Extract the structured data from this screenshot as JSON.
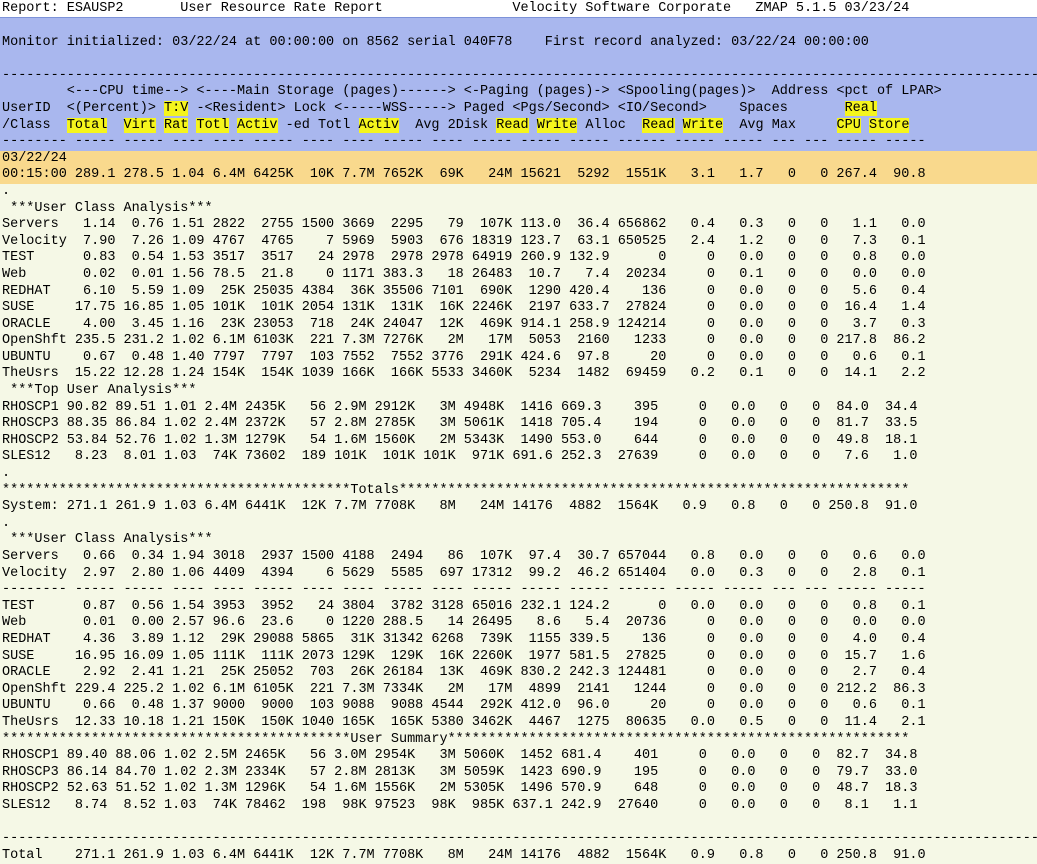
{
  "title_bar": "Report: ESAUSP2       User Resource Rate Report                Velocity Software Corporate   ZMAP 5.1.5 03/23/24",
  "monitor_line": "Monitor initialized: 03/22/24 at 00:00:00 on 8562 serial 040F78    First record analyzed: 03/22/24 00:00:00",
  "header": {
    "sep": "------------------------------------------------------------------------------------------------------------------------------------",
    "h1": "        <---CPU time--> <----Main Storage (pages)------> <-Paging (pages)-> <Spooling(pages)>  Address <pct of LPAR>",
    "h2_a": "UserID  <(Percent)> ",
    "h2_tv": "T:V",
    "h2_b": " -<Resident> Lock <-----WSS-----> Paged <Pgs/Second> <IO/Second>    Spaces       ",
    "h2_real": "Real",
    "h3_a": "/Class  ",
    "h3_total": "Total",
    "h3_s1": "  ",
    "h3_virt": "Virt",
    "h3_s2": " ",
    "h3_rat": "Rat",
    "h3_s3": " ",
    "h3_totl": "Totl",
    "h3_s4": " ",
    "h3_activ": "Activ",
    "h3_s5": " -ed Totl ",
    "h3_activ2": "Activ",
    "h3_s6": "  Avg 2Disk ",
    "h3_read": "Read",
    "h3_s7": " ",
    "h3_write": "Write",
    "h3_s8": " Alloc  ",
    "h3_read2": "Read",
    "h3_s9": " ",
    "h3_write2": "Write",
    "h3_s10": "  Avg Max     ",
    "h3_cpu": "CPU",
    "h3_s11": " ",
    "h3_store": "Store",
    "h4": "-------- ----- ----- ---- ---- ----- ---- ---- ----- ---- ----- ----- ----- ------ ----- ----- --- --- ----- -----"
  },
  "first_block": {
    "date": "03/22/24",
    "row": "00:15:00 289.1 278.5 1.04 6.4M 6425K  10K 7.7M 7652K  69K   24M 15621  5292  1551K   3.1   1.7   0   0 267.4  90.8"
  },
  "lines": [
    ".",
    " ***User Class Analysis***",
    "Servers   1.14  0.76 1.51 2822  2755 1500 3669  2295   79  107K 113.0  36.4 656862   0.4   0.3   0   0   1.1   0.0",
    "Velocity  7.90  7.26 1.09 4767  4765    7 5969  5903  676 18319 123.7  63.1 650525   2.4   1.2   0   0   7.3   0.1",
    "TEST      0.83  0.54 1.53 3517  3517   24 2978  2978 2978 64919 260.9 132.9      0     0   0.0   0   0   0.8   0.0",
    "Web       0.02  0.01 1.56 78.5  21.8    0 1171 383.3   18 26483  10.7   7.4  20234     0   0.1   0   0   0.0   0.0",
    "REDHAT    6.10  5.59 1.09  25K 25035 4384  36K 35506 7101  690K  1290 420.4    136     0   0.0   0   0   5.6   0.4",
    "SUSE     17.75 16.85 1.05 101K  101K 2054 131K  131K  16K 2246K  2197 633.7  27824     0   0.0   0   0  16.4   1.4",
    "ORACLE    4.00  3.45 1.16  23K 23053  718  24K 24047  12K  469K 914.1 258.9 124214     0   0.0   0   0   3.7   0.3",
    "OpenShft 235.5 231.2 1.02 6.1M 6103K  221 7.3M 7276K   2M   17M  5053  2160   1233     0   0.0   0   0 217.8  86.2",
    "UBUNTU    0.67  0.48 1.40 7797  7797  103 7552  7552 3776  291K 424.6  97.8     20     0   0.0   0   0   0.6   0.1",
    "TheUsrs  15.22 12.28 1.24 154K  154K 1039 166K  166K 5533 3460K  5234  1482  69459   0.2   0.1   0   0  14.1   2.2",
    " ***Top User Analysis***",
    "RHOSCP1 90.82 89.51 1.01 2.4M 2435K   56 2.9M 2912K   3M 4948K  1416 669.3    395     0   0.0   0   0  84.0  34.4",
    "RHOSCP3 88.35 86.84 1.02 2.4M 2372K   57 2.8M 2785K   3M 5061K  1418 705.4    194     0   0.0   0   0  81.7  33.5",
    "RHOSCP2 53.84 52.76 1.02 1.3M 1279K   54 1.6M 1560K   2M 5343K  1490 553.0    644     0   0.0   0   0  49.8  18.1",
    "SLES12   8.23  8.01 1.03  74K 73602  189 101K  101K 101K  971K 691.6 252.3  27639     0   0.0   0   0   7.6   1.0",
    ".",
    "*******************************************Totals***************************************************************",
    "System: 271.1 261.9 1.03 6.4M 6441K  12K 7.7M 7708K   8M   24M 14176  4882  1564K   0.9   0.8   0   0 250.8  91.0",
    ".",
    " ***User Class Analysis***",
    "Servers   0.66  0.34 1.94 3018  2937 1500 4188  2494   86  107K  97.4  30.7 657044   0.8   0.0   0   0   0.6   0.0",
    "Velocity  2.97  2.80 1.06 4409  4394    6 5629  5585  697 17312  99.2  46.2 651404   0.0   0.3   0   0   2.8   0.1",
    "-------- ----- ----- ---- ---- ----- ---- ---- ----- ---- ----- ----- ----- ------ ----- ----- --- --- ----- -----",
    "TEST      0.87  0.56 1.54 3953  3952   24 3804  3782 3128 65016 232.1 124.2      0   0.0   0.0   0   0   0.8   0.1",
    "Web       0.01  0.00 2.57 96.6  23.6    0 1220 288.5   14 26495   8.6   5.4  20736     0   0.0   0   0   0.0   0.0",
    "REDHAT    4.36  3.89 1.12  29K 29088 5865  31K 31342 6268  739K  1155 339.5    136     0   0.0   0   0   4.0   0.4",
    "SUSE     16.95 16.09 1.05 111K  111K 2073 129K  129K  16K 2260K  1977 581.5  27825     0   0.0   0   0  15.7   1.6",
    "ORACLE    2.92  2.41 1.21  25K 25052  703  26K 26184  13K  469K 830.2 242.3 124481     0   0.0   0   0   2.7   0.4",
    "OpenShft 229.4 225.2 1.02 6.1M 6105K  221 7.3M 7334K   2M   17M  4899  2141   1244     0   0.0   0   0 212.2  86.3",
    "UBUNTU    0.66  0.48 1.37 9000  9000  103 9088  9088 4544  292K 412.0  96.0     20     0   0.0   0   0   0.6   0.1",
    "TheUsrs  12.33 10.18 1.21 150K  150K 1040 165K  165K 5380 3462K  4467  1275  80635   0.0   0.5   0   0  11.4   2.1",
    "*******************************************User Summary*********************************************************",
    "RHOSCP1 89.40 88.06 1.02 2.5M 2465K   56 3.0M 2954K   3M 5060K  1452 681.4    401     0   0.0   0   0  82.7  34.8",
    "RHOSCP3 86.14 84.70 1.02 2.3M 2334K   57 2.8M 2813K   3M 5059K  1423 690.9    195     0   0.0   0   0  79.7  33.0",
    "RHOSCP2 52.63 51.52 1.02 1.3M 1296K   54 1.6M 1556K   2M 5305K  1496 570.9    648     0   0.0   0   0  48.7  18.3",
    "SLES12   8.74  8.52 1.03  74K 78462  198  98K 97523  98K  985K 637.1 242.9  27640     0   0.0   0   0   8.1   1.1",
    "",
    "------------------------------------------------------------------------------------------------------------------------------------",
    "Total    271.1 261.9 1.03 6.4M 6441K  12K 7.7M 7708K   8M   24M 14176  4882  1564K   0.9   0.8   0   0 250.8  91.0"
  ]
}
